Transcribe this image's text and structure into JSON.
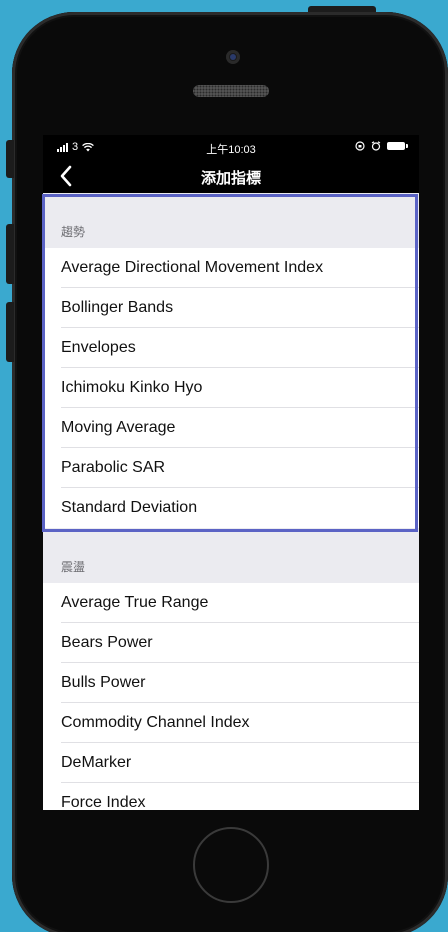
{
  "status_bar": {
    "carrier": "3",
    "time": "上午10:03"
  },
  "nav": {
    "title": "添加指標"
  },
  "sections": [
    {
      "header": "趨勢",
      "items": [
        "Average Directional Movement Index",
        "Bollinger Bands",
        "Envelopes",
        "Ichimoku Kinko Hyo",
        "Moving Average",
        "Parabolic SAR",
        "Standard Deviation"
      ]
    },
    {
      "header": "震盪",
      "items": [
        "Average True Range",
        "Bears Power",
        "Bulls Power",
        "Commodity Channel Index",
        "DeMarker",
        "Force Index"
      ]
    }
  ],
  "colors": {
    "background": "#3aa9cf",
    "highlight": "#5b63c5",
    "section_bg": "#ebebf0"
  }
}
